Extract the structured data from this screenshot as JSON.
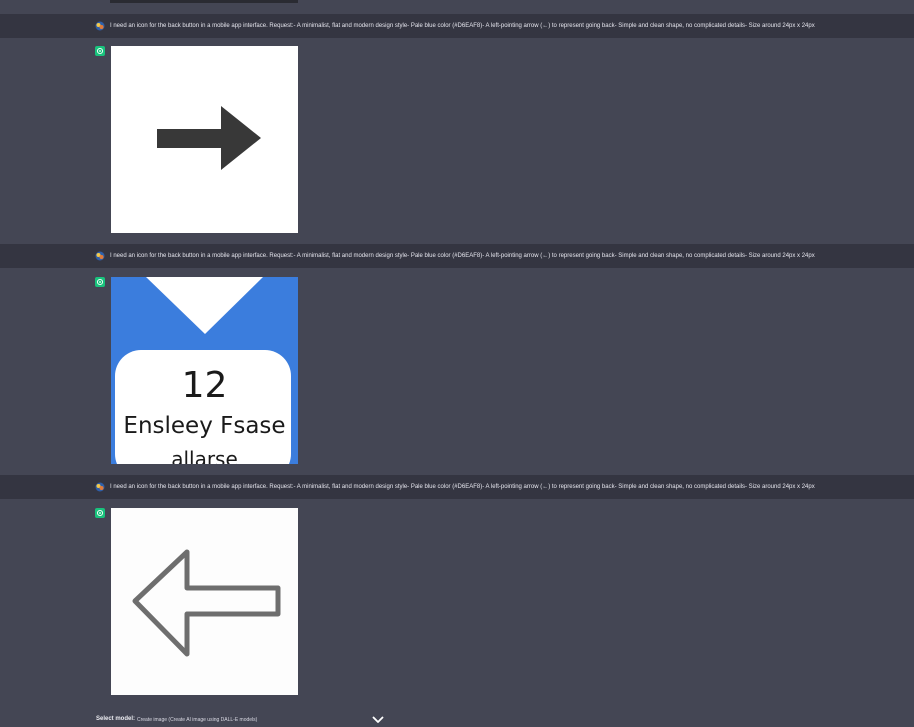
{
  "messages": [
    {
      "prompt": "I need an icon for the back button in a mobile app interface. Request:- A minimalist, flat and modern design style- Pale blue color (#D6EAF8)- A left-pointing arrow (←) to represent going back- Simple and clean shape, no complicated details- Size around 24px x 24px",
      "image_icon": "right-arrow-image"
    },
    {
      "prompt": "I need an icon for the back button in a mobile app interface. Request:- A minimalist, flat and modern design style- Pale blue color (#D6EAF8)- A left-pointing arrow (←) to represent going back- Simple and clean shape, no complicated details- Size around 24px x 24px",
      "image_icon": "card-image",
      "image_text": {
        "number": "12",
        "line1": "Ensleey Fsase",
        "line2": "allarse"
      }
    },
    {
      "prompt": "I need an icon for the back button in a mobile app interface. Request:- A minimalist, flat and modern design style- Pale blue color (#D6EAF8)- A left-pointing arrow (←) to represent going back- Simple and clean shape, no complicated details- Size around 24px x 24px",
      "image_icon": "left-arrow-outline-image"
    }
  ],
  "footer": {
    "label": "Select model:",
    "value": "Create image (Create AI image using DALL-E models)",
    "dropdown_icon": "chevron-down-icon"
  },
  "colors": {
    "page_bg": "#444654",
    "user_row_bg": "#343541",
    "bot_avatar": "#19c37d",
    "card_blue": "#3b7ddd"
  }
}
